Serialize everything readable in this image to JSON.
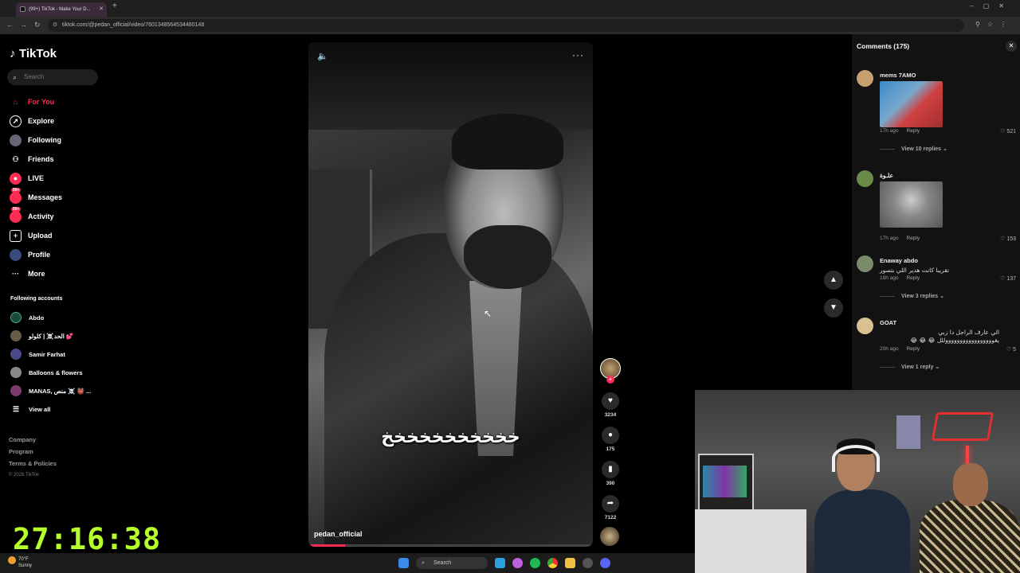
{
  "browser": {
    "tab_title": "(99+) TikTok - Make Your D...",
    "url": "tiktok.com/@pedan_official/video/7601348564534480148"
  },
  "sidebar": {
    "brand": "TikTok",
    "search_placeholder": "Search",
    "nav": [
      {
        "label": "For You",
        "icon": "home-icon",
        "active": true
      },
      {
        "label": "Explore",
        "icon": "compass-icon"
      },
      {
        "label": "Following",
        "icon": "following-icon"
      },
      {
        "label": "Friends",
        "icon": "friends-icon"
      },
      {
        "label": "LIVE",
        "icon": "live-icon"
      },
      {
        "label": "Messages",
        "icon": "messages-icon",
        "badge": "99+"
      },
      {
        "label": "Activity",
        "icon": "activity-icon",
        "badge": "99+"
      },
      {
        "label": "Upload",
        "icon": "upload-icon"
      },
      {
        "label": "Profile",
        "icon": "profile-icon"
      },
      {
        "label": "More",
        "icon": "more-icon"
      }
    ],
    "following_title": "Following accounts",
    "accounts": [
      "Abdo",
      "الحد☠️ | كلولو 💕",
      "Samir Farhat",
      "Balloons & flowers",
      "MANAS, منص ☠️ 👹 ..."
    ],
    "view_all": "View all",
    "footer": {
      "company": "Company",
      "program": "Program",
      "terms": "Terms & Policies",
      "copyright": "© 2026 TikTok"
    }
  },
  "timer": "27:16:38",
  "video": {
    "caption": "خخخخخخخخخخخ",
    "author": "pedan_official",
    "progress": 0.13
  },
  "actions": {
    "likes": "3234",
    "comments": "175",
    "saves": "390",
    "shares": "7122"
  },
  "comments_panel": {
    "title": "Comments (175)",
    "items": [
      {
        "name": "mems 7AMO",
        "time": "17h ago",
        "reply": "Reply",
        "likes": "521",
        "view_replies": "View 10 replies"
      },
      {
        "name": "علـوة",
        "time": "17h ago",
        "reply": "Reply",
        "likes": "153"
      },
      {
        "name": "Enaway abdo",
        "text": "تقريبا كانت هدير اللي بتصور",
        "time": "18h ago",
        "reply": "Reply",
        "likes": "137",
        "view_replies": "View 3 replies"
      },
      {
        "name": "GOAT",
        "text": "الي عارف الراجل دا زبي يقوووووووووووووووووللل 😂 😂 😂",
        "time": "20h ago",
        "reply": "Reply",
        "likes": "5",
        "view_replies": "View 1 reply"
      }
    ]
  },
  "taskbar": {
    "temp": "70°F",
    "condition": "Sunny",
    "search": "Search"
  }
}
